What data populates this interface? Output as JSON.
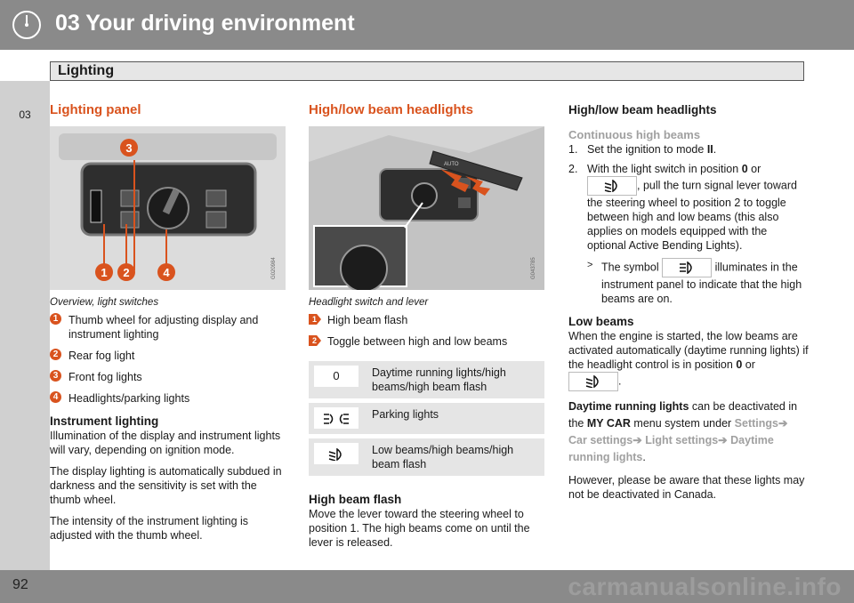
{
  "header": {
    "chapter_title": "03 Your driving environment",
    "section_title": "Lighting"
  },
  "side_tab": {
    "chapter_number": "03"
  },
  "footer": {
    "page_number": "92",
    "watermark": "carmanualsonline.info"
  },
  "col1": {
    "heading": "Lighting panel",
    "figure": {
      "callouts": [
        "3",
        "1",
        "2",
        "4"
      ],
      "code": "G020984"
    },
    "caption": "Overview, light switches",
    "items": [
      {
        "num": "1",
        "text": "Thumb wheel for adjusting display and instrument lighting"
      },
      {
        "num": "2",
        "text": "Rear fog light"
      },
      {
        "num": "3",
        "text": "Front fog lights"
      },
      {
        "num": "4",
        "text": "Headlights/parking lights"
      }
    ],
    "instr_heading": "Instrument lighting",
    "instr_p1": "Illumination of the display and instrument lights will vary, depending on ignition mode.",
    "instr_p2": "The display lighting is automatically subdued in darkness and the sensitivity is set with the thumb wheel.",
    "instr_p3": "The intensity of the instrument lighting is adjusted with the thumb wheel."
  },
  "col2": {
    "heading": "High/low beam headlights",
    "figure": {
      "code": "G043785",
      "lever_label": "AUTO"
    },
    "caption": "Headlight switch and lever",
    "items": [
      {
        "num": "1",
        "text": "High beam flash"
      },
      {
        "num": "2",
        "text": "Toggle between high and low beams"
      }
    ],
    "table": [
      {
        "symbol": "0",
        "symbol_icon": "zero-position",
        "text": "Daytime running lights/high beams/high beam flash"
      },
      {
        "symbol": "",
        "symbol_icon": "parking-lights-icon",
        "text": "Parking lights"
      },
      {
        "symbol": "",
        "symbol_icon": "low-beam-icon",
        "text": "Low beams/high beams/high beam flash"
      }
    ],
    "flash_heading": "High beam flash",
    "flash_text": "Move the lever toward the steering wheel to position 1. The high beams come on until the lever is released."
  },
  "col3": {
    "heading": "High/low beam headlights",
    "sub_heading": "Continuous high beams",
    "step1_num": "1.",
    "step1_a": "Set the ignition to mode ",
    "step1_b": "II",
    "step1_c": ".",
    "step2_num": "2.",
    "step2_a": "With the light switch in position ",
    "step2_b": "0",
    "step2_c": " or",
    "step2_d": ", pull the turn signal lever toward the steering wheel to position 2 to toggle between high and low beams (this also applies on models equipped with the optional Active Bending Lights).",
    "result_marker": ">",
    "result_a": "The symbol ",
    "result_b": " illuminates in the instrument panel to indicate that the high beams are on.",
    "low_heading": "Low beams",
    "low_a": "When the engine is started, the low beams are activated automatically (daytime running lights) if the headlight control is in position ",
    "low_b": "0",
    "low_c": " or",
    "low_d": ".",
    "drl_bold": "Daytime running lights",
    "drl_a": " can be deactivated in the ",
    "drl_mycar": "MY CAR",
    "drl_b": " menu system under ",
    "drl_link1": "Settings",
    "drl_link2": "Car settings",
    "drl_link3": "Light settings",
    "drl_link4": "Daytime running lights",
    "drl_c": ".",
    "canada": "However, please be aware that these lights may not be deactivated in Canada."
  },
  "colors": {
    "accent": "#d9531e",
    "link_gray": "#a0a0a0",
    "bar_gray": "#8a8a8a"
  }
}
